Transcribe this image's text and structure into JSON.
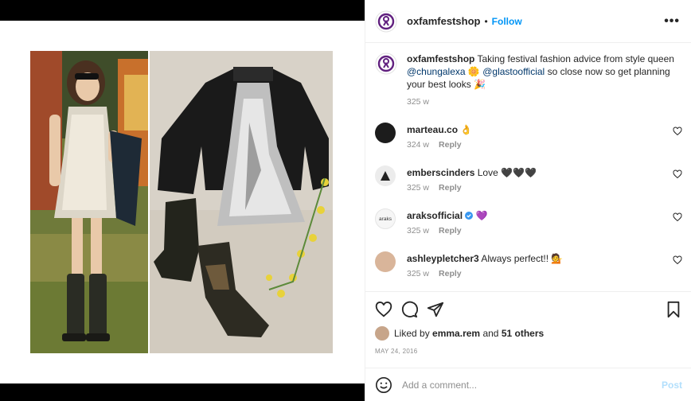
{
  "post": {
    "username": "oxfamfestshop",
    "follow_label": "Follow",
    "separator": "•",
    "more_label": "•••"
  },
  "caption": {
    "username": "oxfamfestshop",
    "text_1": "Taking festival fashion advice from style queen",
    "mention_1": "@chungalexa",
    "emoji_1": "🌼",
    "mention_2": "@glastoofficial",
    "text_2": "so close now so get planning your best looks",
    "emoji_2": "🎉",
    "time": "325 w"
  },
  "comments": [
    {
      "username": "marteau.co",
      "text": "👌",
      "time": "324 w",
      "reply": "Reply",
      "avatar": "#1c1c1c"
    },
    {
      "username": "emberscinders",
      "text": "Love 🖤🖤🖤",
      "time": "325 w",
      "reply": "Reply",
      "avatar": "#e8e8e8"
    },
    {
      "username": "araksofficial",
      "text": "💜",
      "time": "325 w",
      "reply": "Reply",
      "avatar": "#f6f6f6",
      "avatar_text": "araks",
      "verified": true
    },
    {
      "username": "ashleypletcher3",
      "text": "Always perfect!! 💁",
      "time": "325 w",
      "reply": "Reply",
      "avatar": "#d9b59a"
    }
  ],
  "likes": {
    "prefix": "Liked by",
    "user": "emma.rem",
    "and": "and",
    "others": "51 others"
  },
  "date": "MAY 24, 2016",
  "add_comment": {
    "placeholder": "Add a comment...",
    "post_label": "Post"
  },
  "colors": {
    "accent": "#0095f6",
    "brand_purple": "#61207f",
    "muted": "#8e8e8e"
  }
}
